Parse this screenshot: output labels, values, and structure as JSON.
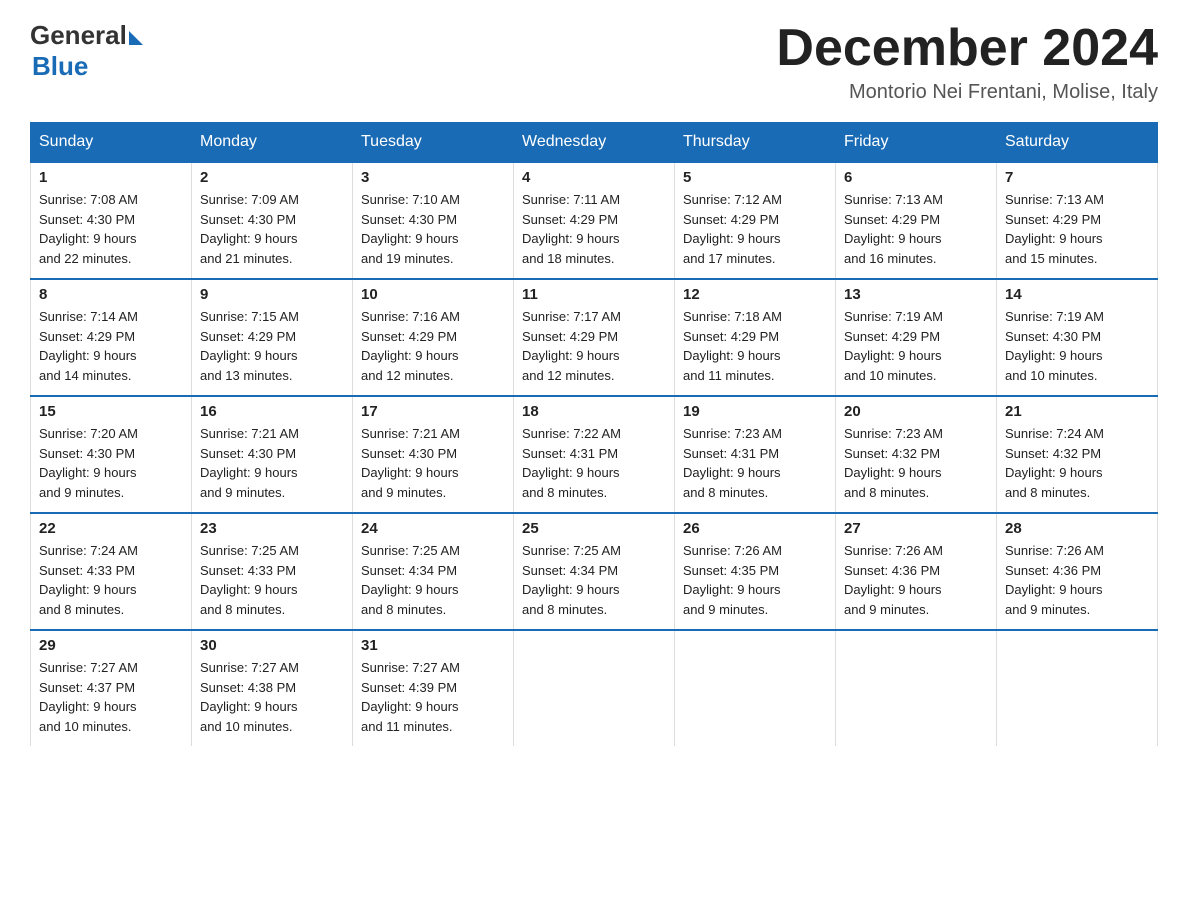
{
  "header": {
    "logo_general": "General",
    "logo_blue": "Blue",
    "month_title": "December 2024",
    "location": "Montorio Nei Frentani, Molise, Italy"
  },
  "weekdays": [
    "Sunday",
    "Monday",
    "Tuesday",
    "Wednesday",
    "Thursday",
    "Friday",
    "Saturday"
  ],
  "weeks": [
    [
      {
        "day": "1",
        "sunrise": "7:08 AM",
        "sunset": "4:30 PM",
        "daylight": "9 hours and 22 minutes."
      },
      {
        "day": "2",
        "sunrise": "7:09 AM",
        "sunset": "4:30 PM",
        "daylight": "9 hours and 21 minutes."
      },
      {
        "day": "3",
        "sunrise": "7:10 AM",
        "sunset": "4:30 PM",
        "daylight": "9 hours and 19 minutes."
      },
      {
        "day": "4",
        "sunrise": "7:11 AM",
        "sunset": "4:29 PM",
        "daylight": "9 hours and 18 minutes."
      },
      {
        "day": "5",
        "sunrise": "7:12 AM",
        "sunset": "4:29 PM",
        "daylight": "9 hours and 17 minutes."
      },
      {
        "day": "6",
        "sunrise": "7:13 AM",
        "sunset": "4:29 PM",
        "daylight": "9 hours and 16 minutes."
      },
      {
        "day": "7",
        "sunrise": "7:13 AM",
        "sunset": "4:29 PM",
        "daylight": "9 hours and 15 minutes."
      }
    ],
    [
      {
        "day": "8",
        "sunrise": "7:14 AM",
        "sunset": "4:29 PM",
        "daylight": "9 hours and 14 minutes."
      },
      {
        "day": "9",
        "sunrise": "7:15 AM",
        "sunset": "4:29 PM",
        "daylight": "9 hours and 13 minutes."
      },
      {
        "day": "10",
        "sunrise": "7:16 AM",
        "sunset": "4:29 PM",
        "daylight": "9 hours and 12 minutes."
      },
      {
        "day": "11",
        "sunrise": "7:17 AM",
        "sunset": "4:29 PM",
        "daylight": "9 hours and 12 minutes."
      },
      {
        "day": "12",
        "sunrise": "7:18 AM",
        "sunset": "4:29 PM",
        "daylight": "9 hours and 11 minutes."
      },
      {
        "day": "13",
        "sunrise": "7:19 AM",
        "sunset": "4:29 PM",
        "daylight": "9 hours and 10 minutes."
      },
      {
        "day": "14",
        "sunrise": "7:19 AM",
        "sunset": "4:30 PM",
        "daylight": "9 hours and 10 minutes."
      }
    ],
    [
      {
        "day": "15",
        "sunrise": "7:20 AM",
        "sunset": "4:30 PM",
        "daylight": "9 hours and 9 minutes."
      },
      {
        "day": "16",
        "sunrise": "7:21 AM",
        "sunset": "4:30 PM",
        "daylight": "9 hours and 9 minutes."
      },
      {
        "day": "17",
        "sunrise": "7:21 AM",
        "sunset": "4:30 PM",
        "daylight": "9 hours and 9 minutes."
      },
      {
        "day": "18",
        "sunrise": "7:22 AM",
        "sunset": "4:31 PM",
        "daylight": "9 hours and 8 minutes."
      },
      {
        "day": "19",
        "sunrise": "7:23 AM",
        "sunset": "4:31 PM",
        "daylight": "9 hours and 8 minutes."
      },
      {
        "day": "20",
        "sunrise": "7:23 AM",
        "sunset": "4:32 PM",
        "daylight": "9 hours and 8 minutes."
      },
      {
        "day": "21",
        "sunrise": "7:24 AM",
        "sunset": "4:32 PM",
        "daylight": "9 hours and 8 minutes."
      }
    ],
    [
      {
        "day": "22",
        "sunrise": "7:24 AM",
        "sunset": "4:33 PM",
        "daylight": "9 hours and 8 minutes."
      },
      {
        "day": "23",
        "sunrise": "7:25 AM",
        "sunset": "4:33 PM",
        "daylight": "9 hours and 8 minutes."
      },
      {
        "day": "24",
        "sunrise": "7:25 AM",
        "sunset": "4:34 PM",
        "daylight": "9 hours and 8 minutes."
      },
      {
        "day": "25",
        "sunrise": "7:25 AM",
        "sunset": "4:34 PM",
        "daylight": "9 hours and 8 minutes."
      },
      {
        "day": "26",
        "sunrise": "7:26 AM",
        "sunset": "4:35 PM",
        "daylight": "9 hours and 9 minutes."
      },
      {
        "day": "27",
        "sunrise": "7:26 AM",
        "sunset": "4:36 PM",
        "daylight": "9 hours and 9 minutes."
      },
      {
        "day": "28",
        "sunrise": "7:26 AM",
        "sunset": "4:36 PM",
        "daylight": "9 hours and 9 minutes."
      }
    ],
    [
      {
        "day": "29",
        "sunrise": "7:27 AM",
        "sunset": "4:37 PM",
        "daylight": "9 hours and 10 minutes."
      },
      {
        "day": "30",
        "sunrise": "7:27 AM",
        "sunset": "4:38 PM",
        "daylight": "9 hours and 10 minutes."
      },
      {
        "day": "31",
        "sunrise": "7:27 AM",
        "sunset": "4:39 PM",
        "daylight": "9 hours and 11 minutes."
      },
      null,
      null,
      null,
      null
    ]
  ],
  "labels": {
    "sunrise": "Sunrise:",
    "sunset": "Sunset:",
    "daylight": "Daylight:"
  }
}
